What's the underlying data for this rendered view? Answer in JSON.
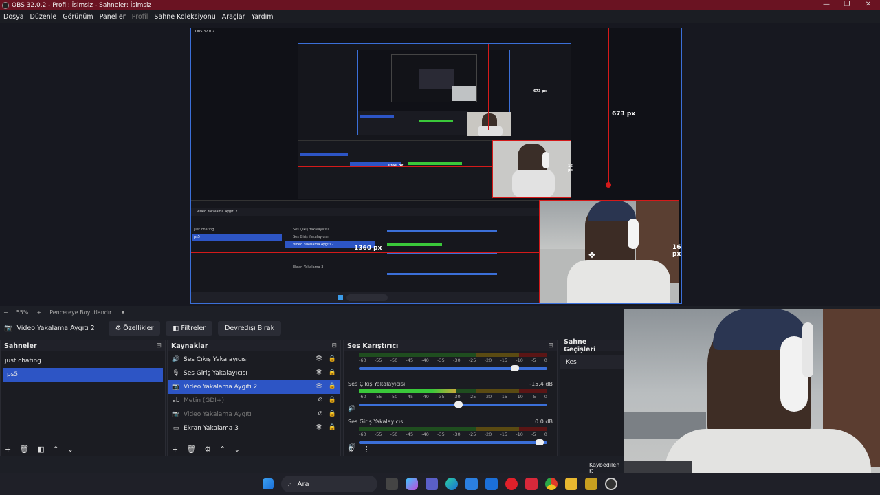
{
  "window": {
    "title": "OBS 32.0.2 - Profil: İsimsiz - Sahneler: İsimsiz",
    "controls": [
      "—",
      "❐",
      "✕"
    ]
  },
  "menu": {
    "items": [
      "Dosya",
      "Düzenle",
      "Görünüm",
      "Paneller",
      "Profil",
      "Sahne Koleksiyonu",
      "Araçlar",
      "Yardım"
    ]
  },
  "preview": {
    "measure_top": "673 px",
    "measure_side": "16 px",
    "measure_left": "1360 px",
    "inner_measure_top": "673 px",
    "inner_measure_side": "16 px",
    "inner_measure_left": "1360 px"
  },
  "zoom": {
    "minus": "−",
    "level": "55%",
    "plus": "+",
    "fit": "Pencereye Boyutlandır"
  },
  "source_toolbar": {
    "source_name": "Video Yakalama Aygıtı 2",
    "properties_label": "Özellikler",
    "filters_label": "Filtreler",
    "deactivate_label": "Devredışı Bırak"
  },
  "scenes": {
    "title": "Sahneler",
    "items": [
      {
        "label": "just chating",
        "active": false
      },
      {
        "label": "ps5",
        "active": true
      }
    ]
  },
  "sources": {
    "title": "Kaynaklar",
    "items": [
      {
        "label": "Ses Çıkış Yakalayıcısı",
        "icon": "🔊",
        "active": false,
        "disabled": false
      },
      {
        "label": "Ses Giriş Yakalayıcısı",
        "icon": "🎙",
        "active": false,
        "disabled": false
      },
      {
        "label": "Video Yakalama Aygıtı 2",
        "icon": "📷",
        "active": true,
        "disabled": false
      },
      {
        "label": "Metin (GDI+)",
        "icon": "ab",
        "active": false,
        "disabled": true
      },
      {
        "label": "Video Yakalama Aygıtı",
        "icon": "📷",
        "active": false,
        "disabled": true
      },
      {
        "label": "Ekran Yakalama 3",
        "icon": "▭",
        "active": false,
        "disabled": false
      }
    ]
  },
  "mixer": {
    "title": "Ses Karıştırıcı",
    "ticks": [
      "-60",
      "-55",
      "-50",
      "-45",
      "-40",
      "-35",
      "-30",
      "-25",
      "-20",
      "-15",
      "-10",
      "-5",
      "0"
    ],
    "channels": [
      {
        "name": "",
        "db": "",
        "level": 0.0,
        "volume": 0.85
      },
      {
        "name": "Ses Çıkış Yakalayıcısı",
        "db": "-15.4 dB",
        "level": 0.52,
        "volume": 0.55
      },
      {
        "name": "Ses Giriş Yakalayıcısı",
        "db": "0.0 dB",
        "level": 0.0,
        "volume": 0.98
      }
    ]
  },
  "transitions": {
    "title": "Sahne Geçişleri",
    "current": "Kes"
  },
  "status": {
    "dropped": "Kaybedilen K"
  },
  "taskbar": {
    "search_placeholder": "Ara",
    "icons": [
      "windows-start-icon",
      "task-view-icon",
      "copilot-icon",
      "teams-icon",
      "edge-icon",
      "store-icon",
      "outlook-icon",
      "opera-icon",
      "office-icon",
      "chrome-icon",
      "explorer-icon",
      "app-icon",
      "obs-icon"
    ]
  }
}
